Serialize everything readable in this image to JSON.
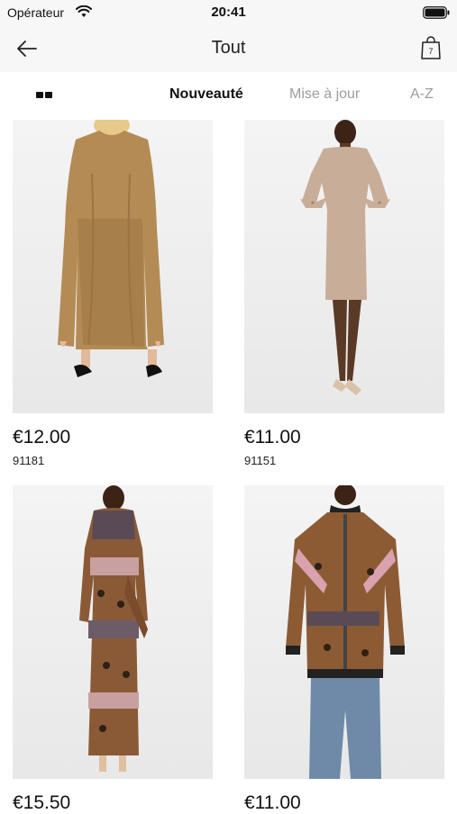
{
  "status_bar": {
    "carrier": "Opérateur",
    "time": "20:41"
  },
  "nav": {
    "title": "Tout",
    "back_icon": "arrow-left-icon",
    "cart_icon": "shopping-bag-icon",
    "cart_count": "7"
  },
  "sort_bar": {
    "view_icon": "grid-view-icon",
    "tabs": [
      {
        "label": "Nouveauté",
        "active": true
      },
      {
        "label": "Mise à jour",
        "active": false
      },
      {
        "label": "A-Z",
        "active": false
      }
    ]
  },
  "products": [
    {
      "price": "€12.00",
      "sku": "91181",
      "image": "camel-maxi-dress-photo"
    },
    {
      "price": "€11.00",
      "sku": "91151",
      "image": "beige-knit-dress-photo"
    },
    {
      "price": "€15.50",
      "sku": "",
      "image": "leopard-scarf-print-dress-photo"
    },
    {
      "price": "€11.00",
      "sku": "",
      "image": "leopard-scarf-print-bomber-photo"
    }
  ]
}
